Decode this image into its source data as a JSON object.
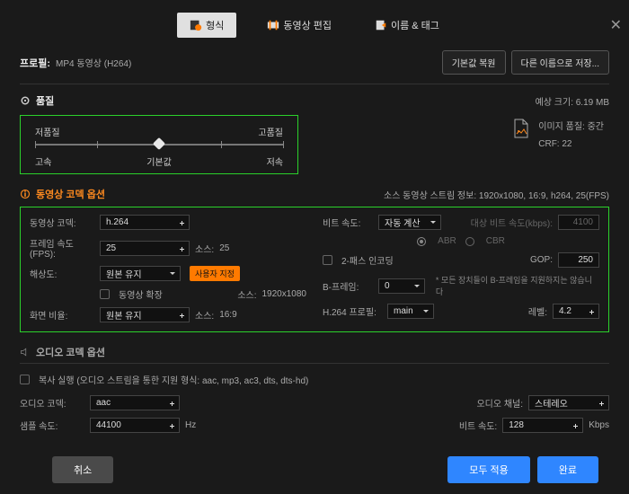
{
  "tabs": {
    "format": "형식",
    "edit": "동영상 편집",
    "tags": "이름 & 태그"
  },
  "profile": {
    "label": "프로필:",
    "value": "MP4 동영상 (H264)"
  },
  "buttons": {
    "restore": "기본값 복원",
    "saveas": "다른 이름으로 저장...",
    "user_set": "사용자 지정",
    "cancel": "취소",
    "apply_all": "모두 적용",
    "done": "완료"
  },
  "quality_section": {
    "title": "품질",
    "size_label": "예상 크기: 6.19 MB",
    "low_q": "저품질",
    "high_q": "고품질",
    "fast": "고속",
    "default": "기본값",
    "slow": "저속"
  },
  "image_info": {
    "quality": "이미지 품질: 중간",
    "crf": "CRF: 22"
  },
  "video_section": {
    "title": "동영상 코덱 옵션",
    "stream_info": "소스 동영상 스트림 정보: 1920x1080, 16:9, h264, 25(FPS)"
  },
  "labels": {
    "vcodec": "동영상 코덱:",
    "fps": "프레임 속도(FPS):",
    "res": "해상도:",
    "ext_video": "동영상 확장",
    "aspect": "화면 비율:",
    "bitrate": "비트 속도:",
    "target_bitrate": "대상 비트 속도(kbps):",
    "twopass": "2-패스 인코딩",
    "gop": "GOP:",
    "bframe": "B-프레임:",
    "bframe_note": "* 모든 장치들이 B-프레임을 지원하지는 않습니다",
    "h264_profile": "H.264 프로필:",
    "level": "레벨:",
    "source": "소스:",
    "abr": "ABR",
    "cbr": "CBR"
  },
  "values": {
    "vcodec": "h.264",
    "fps": "25",
    "fps_src": "25",
    "res": "원본 유지",
    "res_src": "1920x1080",
    "aspect": "원본 유지",
    "aspect_src": "16:9",
    "bitrate": "자동 계산",
    "target_bitrate": "4100",
    "gop": "250",
    "bframe": "0",
    "h264_profile": "main",
    "level": "4.2"
  },
  "audio_section": {
    "title": "오디오 코덱 옵션"
  },
  "audio": {
    "copy_label": "복사 실행 (오디오 스트림을 통한 지원 형식: aac, mp3, ac3, dts, dts-hd)",
    "acodec_label": "오디오 코덱:",
    "acodec": "aac",
    "channels_label": "오디오 채널:",
    "channels": "스테레오",
    "srate_label": "샘플 속도:",
    "srate": "44100",
    "hz": "Hz",
    "abitrate_label": "비트 속도:",
    "abitrate": "128",
    "kbps": "Kbps"
  }
}
